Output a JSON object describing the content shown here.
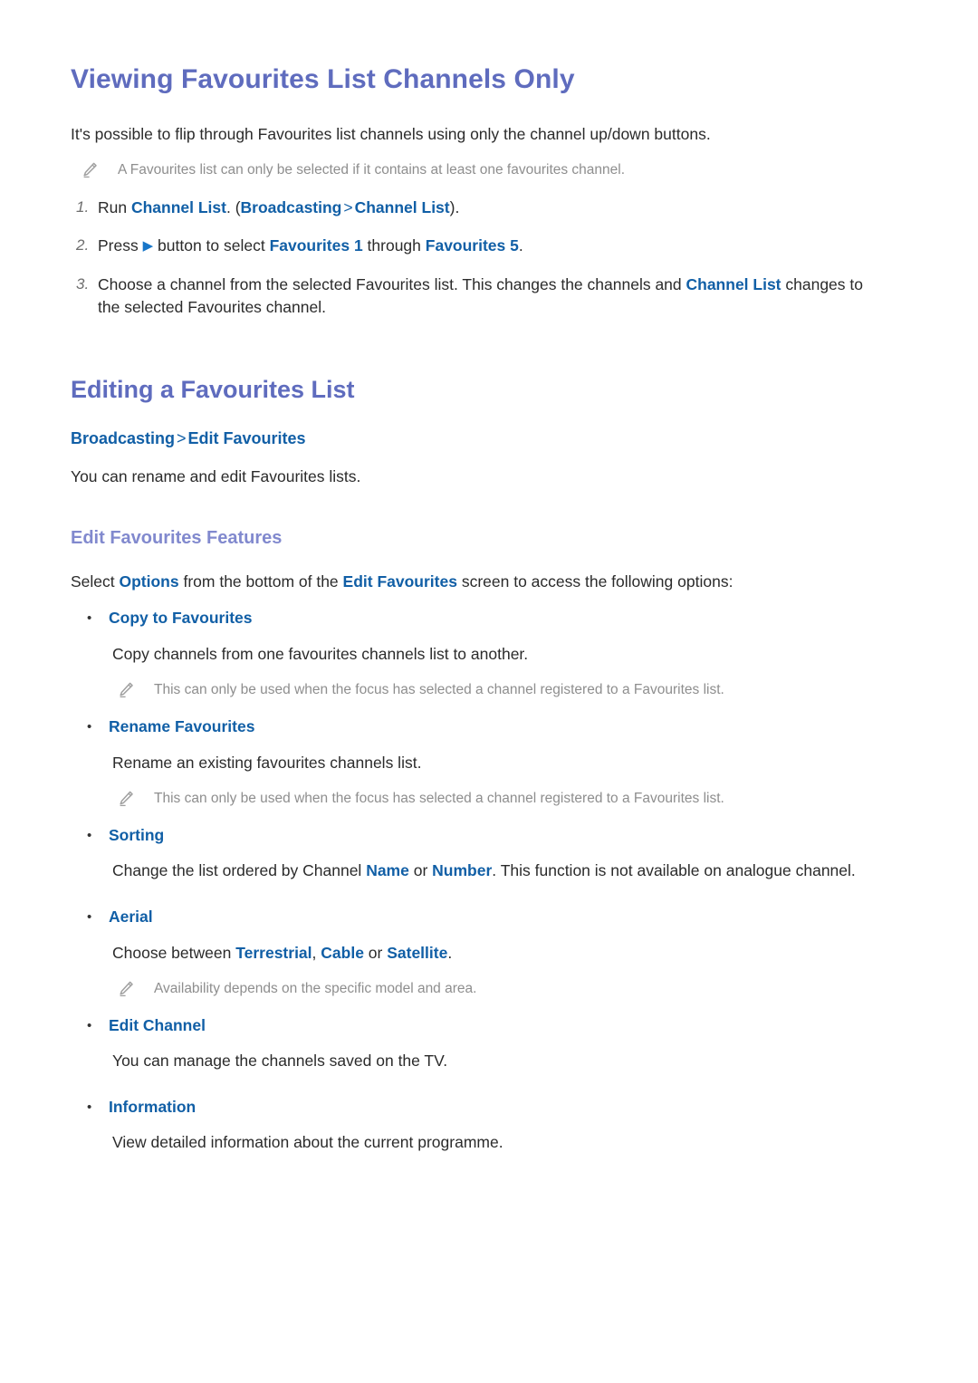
{
  "document": {
    "section1": {
      "title": "Viewing Favourites List Channels Only",
      "intro": "It's possible to flip through Favourites list channels using only the channel up/down buttons.",
      "note": "A Favourites list can only be selected if it contains at least one favourites channel.",
      "steps": [
        {
          "number": "1.",
          "pre": "Run ",
          "link1": "Channel List",
          "mid1": ". (",
          "link2": "Broadcasting",
          "separator": ">",
          "link3": "Channel List",
          "post": ")."
        },
        {
          "number": "2.",
          "pre": "Press ",
          "arrow": "▶",
          "mid1": " button to select ",
          "link1": "Favourites 1",
          "mid2": " through ",
          "link2": "Favourites 5",
          "post": "."
        },
        {
          "number": "3.",
          "pre": "Choose a channel from the selected Favourites list. This changes the channels and ",
          "link1": "Channel List",
          "post": " changes to the selected Favourites channel."
        }
      ]
    },
    "section2": {
      "title": "Editing a Favourites List",
      "breadcrumb": {
        "item1": "Broadcasting",
        "separator": ">",
        "item2": "Edit Favourites"
      },
      "intro": "You can rename and edit Favourites lists.",
      "subsection": {
        "title": "Edit Favourites Features",
        "lead": {
          "pre": "Select ",
          "link1": "Options",
          "mid": " from the bottom of the ",
          "link2": "Edit Favourites",
          "post": " screen to access the following options:"
        },
        "options": [
          {
            "bullet": "•",
            "label": "Copy to Favourites",
            "description": "Copy channels from one favourites channels list to another.",
            "note": "This can only be used when the focus has selected a channel registered to a Favourites list."
          },
          {
            "bullet": "•",
            "label": "Rename Favourites",
            "description": "Rename an existing favourites channels list.",
            "note": "This can only be used when the focus has selected a channel registered to a Favourites list."
          },
          {
            "bullet": "•",
            "label": "Sorting",
            "desc_pre": "Change the list ordered by Channel ",
            "desc_link1": "Name",
            "desc_mid": " or ",
            "desc_link2": "Number",
            "desc_post": ". This function is not available on analogue channel.",
            "note": null
          },
          {
            "bullet": "•",
            "label": "Aerial",
            "desc_pre": "Choose between ",
            "desc_link1": "Terrestrial",
            "desc_mid1": ", ",
            "desc_link2": "Cable",
            "desc_mid2": " or ",
            "desc_link3": "Satellite",
            "desc_post": ".",
            "note": "Availability depends on the specific model and area."
          },
          {
            "bullet": "•",
            "label": "Edit Channel",
            "description": "You can manage the channels saved on the TV.",
            "note": null
          },
          {
            "bullet": "•",
            "label": "Information",
            "description": "View detailed information about the current programme.",
            "note": null
          }
        ]
      }
    }
  },
  "colors": {
    "heading": "#5f6cbe",
    "subheading": "#8189ce",
    "link": "#115fa6",
    "body": "#2b2b2b",
    "note": "#8e8e8e"
  }
}
